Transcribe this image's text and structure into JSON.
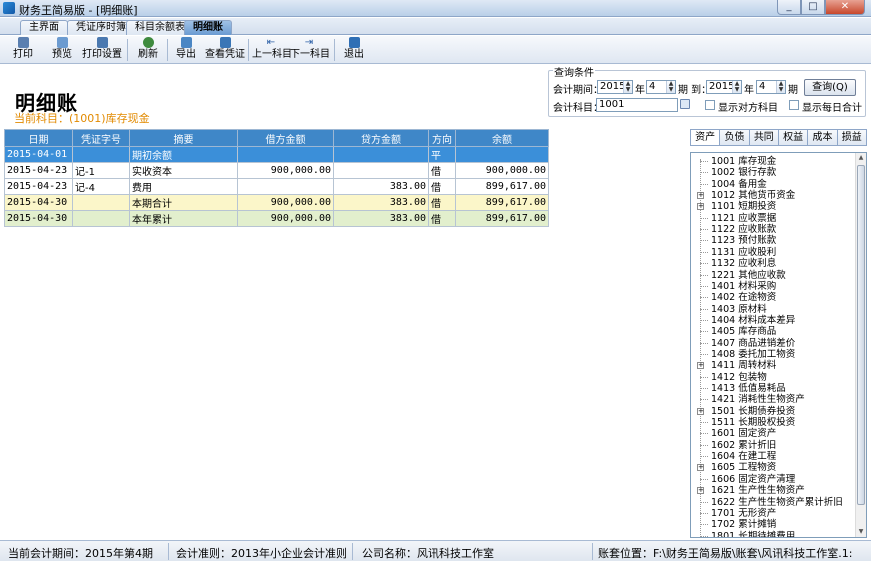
{
  "window": {
    "title": "财务王简易版 - [明细账]",
    "controls": [
      "_",
      "□",
      "✕"
    ]
  },
  "tabs": [
    "主界面",
    "凭证序时簿",
    "科目余额表",
    "明细账"
  ],
  "toolbar": {
    "print": "打印",
    "preview": "预览",
    "print_settings": "打印设置",
    "refresh": "刷新",
    "export": "导出",
    "view_voucher": "查看凭证",
    "prev_subject": "上一科目",
    "next_subject": "下一科目",
    "exit": "退出"
  },
  "header": {
    "title": "明细账",
    "current_subject": "当前科目：(1001)库存现金"
  },
  "query": {
    "legend": "查询条件",
    "period_label": "会计期间：",
    "from_year": "2015",
    "year_label": "年",
    "from_month": "4",
    "to_label": "期 到：",
    "to_year": "2015",
    "year_label2": "年",
    "to_month": "4",
    "period_suffix": "期",
    "search_button": "查询(Q)",
    "subject_label": "会计科目：",
    "subject_value": "1001",
    "show_counter": "显示对方科目",
    "show_daily": "显示每日合计"
  },
  "ledger": {
    "headers": [
      "日期",
      "凭证字号",
      "摘要",
      "借方金额",
      "贷方金额",
      "方向",
      "余额"
    ],
    "rows": [
      {
        "date": "2015-04-01",
        "voucher": "",
        "summary": "期初余额",
        "debit": "",
        "credit": "",
        "dir": "平",
        "balance": ""
      },
      {
        "date": "2015-04-23",
        "voucher": "记-1",
        "summary": "实收资本",
        "debit": "900,000.00",
        "credit": "",
        "dir": "借",
        "balance": "900,000.00"
      },
      {
        "date": "2015-04-23",
        "voucher": "记-4",
        "summary": "费用",
        "debit": "",
        "credit": "383.00",
        "dir": "借",
        "balance": "899,617.00"
      },
      {
        "date": "2015-04-30",
        "voucher": "",
        "summary": "本期合计",
        "debit": "900,000.00",
        "credit": "383.00",
        "dir": "借",
        "balance": "899,617.00"
      },
      {
        "date": "2015-04-30",
        "voucher": "",
        "summary": "本年累计",
        "debit": "900,000.00",
        "credit": "383.00",
        "dir": "借",
        "balance": "899,617.00"
      }
    ]
  },
  "right_tabs": [
    "资产",
    "负债",
    "共同",
    "权益",
    "成本",
    "损益"
  ],
  "tree": [
    {
      "label": "1001 库存现金",
      "exp": false
    },
    {
      "label": "1002 银行存款",
      "exp": false
    },
    {
      "label": "1004 备用金",
      "exp": false
    },
    {
      "label": "1012 其他货币资金",
      "exp": true
    },
    {
      "label": "1101 短期投资",
      "exp": true
    },
    {
      "label": "1121 应收票据",
      "exp": false
    },
    {
      "label": "1122 应收账款",
      "exp": false
    },
    {
      "label": "1123 预付账款",
      "exp": false
    },
    {
      "label": "1131 应收股利",
      "exp": false
    },
    {
      "label": "1132 应收利息",
      "exp": false
    },
    {
      "label": "1221 其他应收款",
      "exp": false
    },
    {
      "label": "1401 材料采购",
      "exp": false
    },
    {
      "label": "1402 在途物资",
      "exp": false
    },
    {
      "label": "1403 原材料",
      "exp": false
    },
    {
      "label": "1404 材料成本差异",
      "exp": false
    },
    {
      "label": "1405 库存商品",
      "exp": false
    },
    {
      "label": "1407 商品进销差价",
      "exp": false
    },
    {
      "label": "1408 委托加工物资",
      "exp": false
    },
    {
      "label": "1411 周转材料",
      "exp": true
    },
    {
      "label": "1412 包装物",
      "exp": false
    },
    {
      "label": "1413 低值易耗品",
      "exp": false
    },
    {
      "label": "1421 消耗性生物资产",
      "exp": false
    },
    {
      "label": "1501 长期债券投资",
      "exp": true
    },
    {
      "label": "1511 长期股权投资",
      "exp": false
    },
    {
      "label": "1601 固定资产",
      "exp": false
    },
    {
      "label": "1602 累计折旧",
      "exp": false
    },
    {
      "label": "1604 在建工程",
      "exp": false
    },
    {
      "label": "1605 工程物资",
      "exp": true
    },
    {
      "label": "1606 固定资产清理",
      "exp": false
    },
    {
      "label": "1621 生产性生物资产",
      "exp": true
    },
    {
      "label": "1622 生产性生物资产累计折旧",
      "exp": false
    },
    {
      "label": "1701 无形资产",
      "exp": false
    },
    {
      "label": "1702 累计摊销",
      "exp": false
    },
    {
      "label": "1801 长期待摊费用",
      "exp": false
    }
  ],
  "status": {
    "period": "当前会计期间：2015年第4期",
    "standard": "会计准则：2013年小企业会计准则",
    "company": "公司名称：风讯科技工作室",
    "path": "账套位置：F:\\财务王简易版\\账套\\风讯科技工作室.1:"
  },
  "colors": {
    "header_blue": "#3f87c8",
    "selected_row": "#3b8fd9",
    "total_row": "#fbf6c9",
    "total_year_row": "#e2efcd",
    "subject_orange": "#e28a00"
  }
}
